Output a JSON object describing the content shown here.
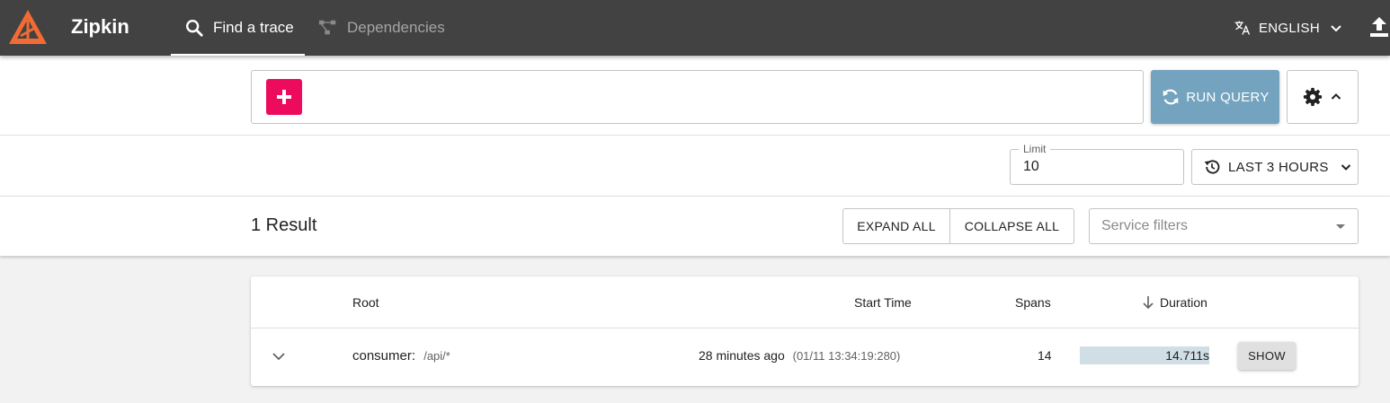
{
  "app": {
    "brand": "Zipkin"
  },
  "nav": {
    "tabs": [
      {
        "label": "Find a trace",
        "icon": "search-icon",
        "active": true
      },
      {
        "label": "Dependencies",
        "icon": "dependencies-icon",
        "active": false
      }
    ],
    "language": "ENGLISH"
  },
  "query": {
    "run_label": "RUN QUERY"
  },
  "limit": {
    "label": "Limit",
    "value": "10"
  },
  "lookback": {
    "label": "LAST 3 HOURS"
  },
  "results": {
    "count_text": "1 Result",
    "expand_all": "EXPAND ALL",
    "collapse_all": "COLLAPSE ALL",
    "service_filter_placeholder": "Service filters"
  },
  "table": {
    "columns": {
      "root": "Root",
      "start_time": "Start Time",
      "spans": "Spans",
      "duration": "Duration"
    },
    "rows": [
      {
        "service": "consumer:",
        "span_name": "/api/*",
        "start_relative": "28 minutes ago",
        "start_absolute": "(01/11 13:34:19:280)",
        "spans": "14",
        "duration": "14.711s",
        "duration_fraction": 1.0,
        "show_label": "SHOW"
      }
    ]
  },
  "colors": {
    "appbar": "#424242",
    "accent_pink": "#ec0b5d",
    "run_query": "#73a3bf",
    "logo_orange": "#f26b34",
    "duration_bar": "#d0dfe5"
  }
}
